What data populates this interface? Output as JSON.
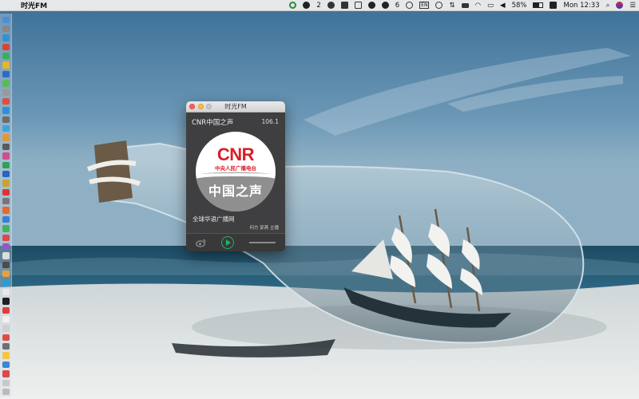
{
  "menubar": {
    "apple_glyph": "",
    "app_name": "时光FM",
    "wechat_count": "2",
    "notification_count": "6",
    "input_method": "EN",
    "battery_percent": "58%",
    "clock": "Mon 12:33",
    "icons": [
      "circle-o-icon",
      "wechat-icon",
      "chat-icon",
      "printer-icon",
      "box-icon",
      "qq-icon",
      "penguin-icon",
      "circle-icon",
      "input-method-icon",
      "time-machine-icon",
      "transfer-icon",
      "network-icon",
      "wifi-icon",
      "airplay-icon",
      "volume-icon",
      "battery-icon",
      "sogou-icon",
      "search-icon",
      "siri-icon",
      "notification-center-icon"
    ]
  },
  "window": {
    "title": "时光FM",
    "station_name": "CNR中国之声",
    "frequency": "106.1",
    "logo": {
      "brand": "CNR",
      "brand_subtitle": "中央人民广播电台",
      "slogan": "中国之声"
    },
    "program_name": "全球华语广播网",
    "hosts": "何方 郭燕 主播"
  },
  "colors": {
    "cnr_red": "#d91e26",
    "play_green": "#1fb36a",
    "window_bg": "#3f3f41"
  }
}
